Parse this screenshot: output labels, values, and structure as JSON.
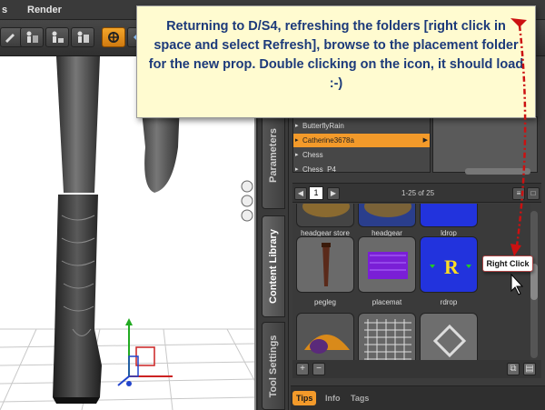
{
  "menubar": {
    "item_s": "s",
    "item_render": "Render"
  },
  "panel_tabs": {
    "parameters": "Parameters",
    "content_library": "Content Library",
    "tool_settings": "Tool Settings"
  },
  "folders": [
    {
      "label": "ButterflyRain",
      "selected": false
    },
    {
      "label": "Catherine3678a",
      "selected": true
    },
    {
      "label": "Chess",
      "selected": false
    },
    {
      "label": "Chess_P4",
      "selected": false
    }
  ],
  "pager": {
    "page": "1",
    "count": "1-25 of 25"
  },
  "grid_items": [
    {
      "label": "headgear store",
      "icon": "hat-thumbnail"
    },
    {
      "label": "headgear",
      "icon": "hat-thumbnail"
    },
    {
      "label": "ldrop",
      "icon": "blue-ldrop-thumbnail"
    },
    {
      "label": "pegleg",
      "icon": "pegleg-thumbnail"
    },
    {
      "label": "placemat",
      "icon": "purple-placemat-thumbnail"
    },
    {
      "label": "rdrop",
      "icon": "blue-rdrop-thumbnail",
      "letter": "R"
    },
    {
      "label": "",
      "icon": "orange-hat-thumbnail"
    },
    {
      "label": "",
      "icon": "lattice-thumbnail"
    },
    {
      "label": "",
      "icon": "diamond-thumbnail"
    }
  ],
  "bottom_tabs": {
    "tips": "Tips",
    "info": "Info",
    "tags": "Tags"
  },
  "annotation": {
    "callout": "Returning to D/S4, refreshing the folders [right click in space and select Refresh], browse to the placement folder for the new prop. Double clicking on the icon, it should load :-)",
    "badge": "Right Click"
  },
  "colors": {
    "accent": "#f39a2a",
    "callout_text": "#1c3a7a",
    "arrow": "#cc1111"
  }
}
